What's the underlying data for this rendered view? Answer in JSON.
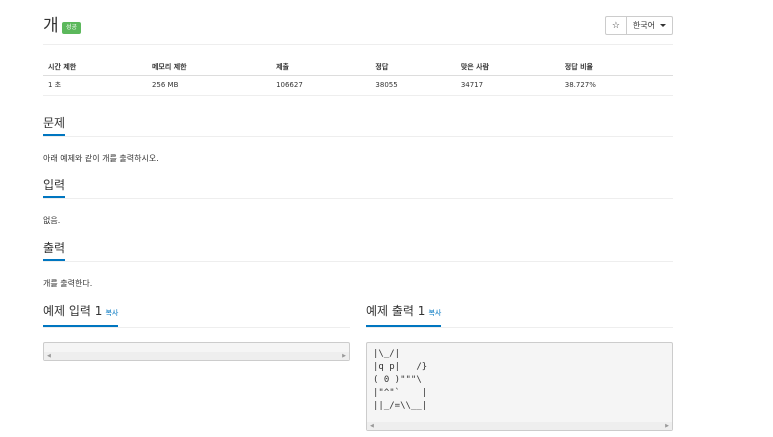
{
  "problem": {
    "title": "개",
    "badge": "성공",
    "star_icon": "☆",
    "language": "한국어"
  },
  "info_table": {
    "headers": [
      "시간 제한",
      "메모리 제한",
      "제출",
      "정답",
      "맞은 사람",
      "정답 비율"
    ],
    "row": [
      "1 초",
      "256 MB",
      "106627",
      "38055",
      "34717",
      "38.727%"
    ]
  },
  "sections": {
    "description_title": "문제",
    "description_text": "아래 예제와 같이 개를 출력하시오.",
    "input_title": "입력",
    "input_text": "없음.",
    "output_title": "출력",
    "output_text": "개를 출력한다."
  },
  "samples": {
    "input_title": "예제 입력 1",
    "output_title": "예제 출력 1",
    "copy_label": "복사",
    "input_value": "",
    "output_value": "|\\_/|\n|q p|   /}\n( 0 )\"\"\"\\\n|\"^\"`    |\n||_/=\\\\__|"
  }
}
